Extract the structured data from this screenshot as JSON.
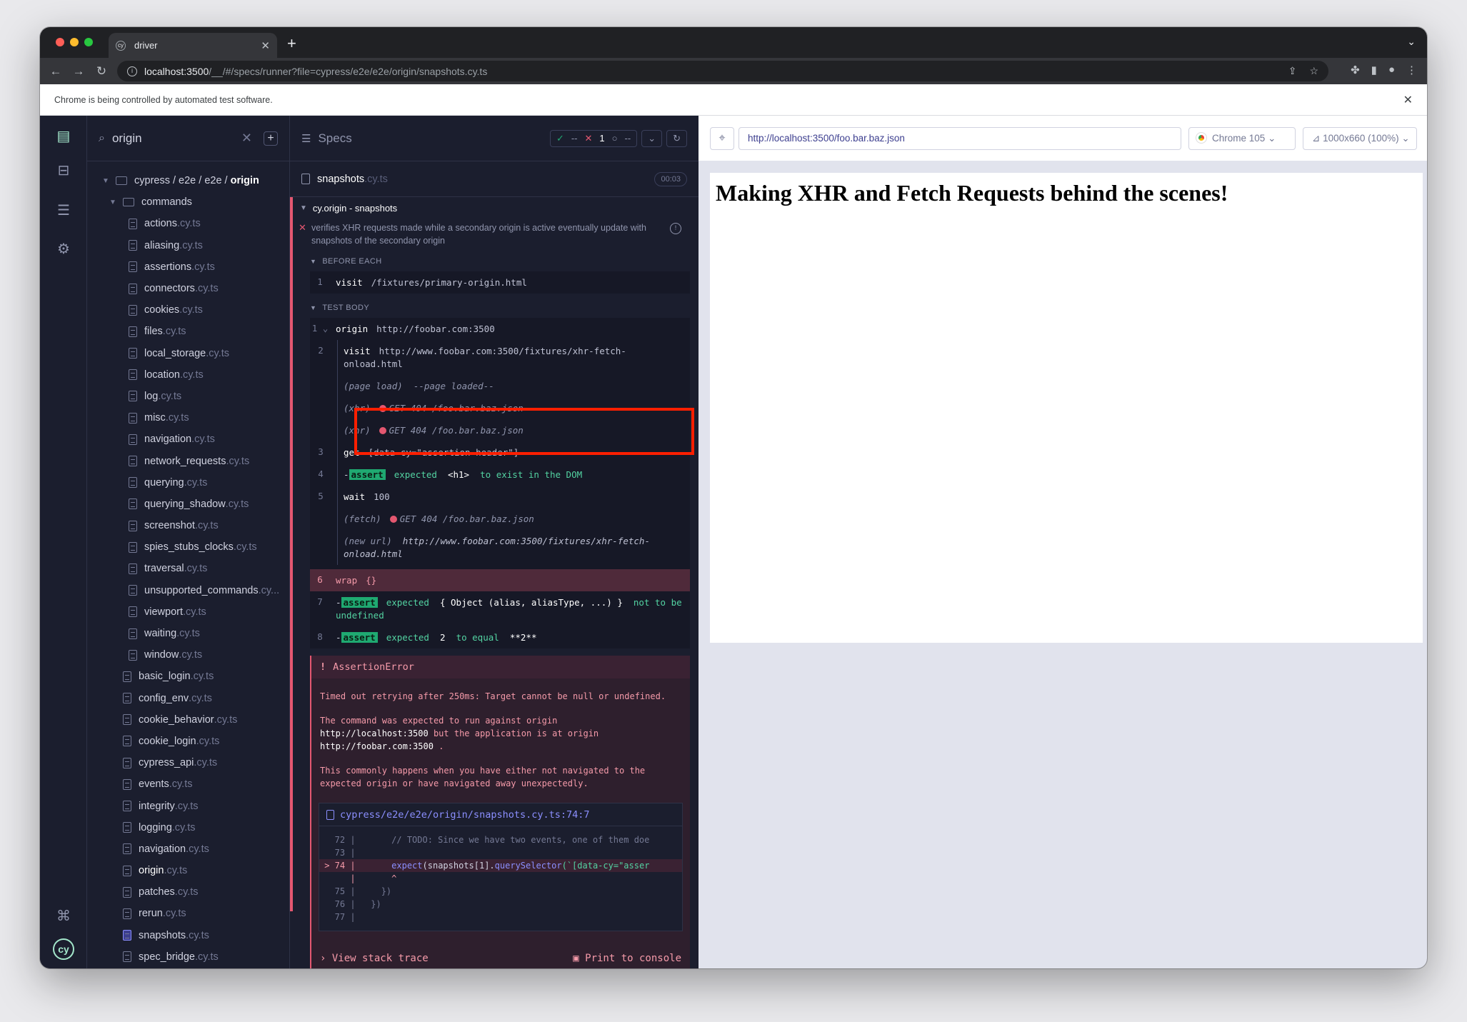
{
  "browser": {
    "tab_title": "driver",
    "url_host": "localhost:3500",
    "url_path": "/__/#/specs/runner?file=cypress/e2e/e2e/origin/snapshots.cy.ts",
    "infobar_text": "Chrome is being controlled by automated test software."
  },
  "sidebar": {
    "search_value": "origin",
    "root_path": "cypress / e2e / e2e / ",
    "root_bold": "origin",
    "commands_folder": "commands",
    "ext": ".cy.ts",
    "command_files": [
      "actions",
      "aliasing",
      "assertions",
      "connectors",
      "cookies",
      "files",
      "local_storage",
      "location",
      "log",
      "misc",
      "navigation",
      "network_requests",
      "querying",
      "querying_shadow",
      "screenshot",
      "spies_stubs_clocks",
      "traversal",
      "unsupported_commands",
      "viewport",
      "waiting",
      "window"
    ],
    "unsupported_ext": ".cy...",
    "origin_files": [
      "basic_login",
      "config_env",
      "cookie_behavior",
      "cookie_login",
      "cypress_api",
      "events",
      "integrity",
      "logging",
      "navigation",
      "origin",
      "patches",
      "rerun",
      "snapshots",
      "spec_bridge"
    ]
  },
  "reporter": {
    "header": "Specs",
    "passed": "--",
    "failed": "1",
    "pending": "--",
    "spec_name": "snapshots",
    "spec_ext": ".cy.ts",
    "time": "00:03",
    "suite": "cy.origin - snapshots",
    "test_title": "verifies XHR requests made while a secondary origin is active eventually update with snapshots of the secondary origin",
    "before_each": "BEFORE EACH",
    "test_body": "TEST BODY",
    "cmd_visit_name": "visit",
    "cmd_visit_arg": "/fixtures/primary-origin.html",
    "origin_name": "origin",
    "origin_arg": "http://foobar.com:3500",
    "visit2_arg": "http://www.foobar.com:3500/fixtures/xhr-fetch-onload.html",
    "page_load_a": "(page load)",
    "page_load_b": "--page loaded--",
    "xhr_label": "(xhr)",
    "xhr_req": "GET 404 /foo.bar.baz.json",
    "get_name": "get",
    "get_arg": "[data-cy=\"assertion-header\"]",
    "assert_label": "assert",
    "assert1_a": "expected",
    "assert1_b": "<h1>",
    "assert1_c": "to exist in the DOM",
    "wait_name": "wait",
    "wait_arg": "100",
    "fetch_label": "(fetch)",
    "fetch_req": "GET 404 /foo.bar.baz.json",
    "newurl_label": "(new url)",
    "newurl_arg": "http://www.foobar.com:3500/fixtures/xhr-fetch-onload.html",
    "wrap_name": "wrap",
    "wrap_arg": "{}",
    "assert2_a": "expected",
    "assert2_b": "{ Object (alias, aliasType, ...) }",
    "assert2_c": "not to be undefined",
    "assert3_a": "expected",
    "assert3_b": "2",
    "assert3_c": "to equal",
    "assert3_d": "**2**",
    "error_title": "AssertionError",
    "error_msg1": "Timed out retrying after 250ms: Target cannot be null or undefined.",
    "error_msg2a": "The command was expected to run against origin",
    "error_msg2b": "http://localhost:3500",
    "error_msg2c": "but the application is at origin",
    "error_msg2d": "http://foobar.com:3500",
    "error_msg2e": ".",
    "error_msg3": "This commonly happens when you have either not navigated to the expected origin or have navigated away unexpectedly.",
    "codeframe_file": "cypress/e2e/e2e/origin/snapshots.cy.ts:74:7",
    "code_72": "   72 |       // TODO: Since we have two events, one of them doe",
    "code_73": "   73 |",
    "code_74a": " > 74 |       ",
    "code_74b": "expect",
    "code_74c": "(snapshots[1].",
    "code_74d": "querySelector",
    "code_74e": "(`[data-cy=\"asser",
    "code_caret": "      |       ^",
    "code_75": "   75 |     })",
    "code_76": "   76 |   })",
    "code_77": "   77 |",
    "view_stack": "View stack trace",
    "print_console": "Print to console"
  },
  "aut": {
    "url": "http://localhost:3500/foo.bar.baz.json",
    "browser": "Chrome 105",
    "viewport": "1000x660 (100%)",
    "heading": "Making XHR and Fetch Requests behind the scenes!"
  }
}
